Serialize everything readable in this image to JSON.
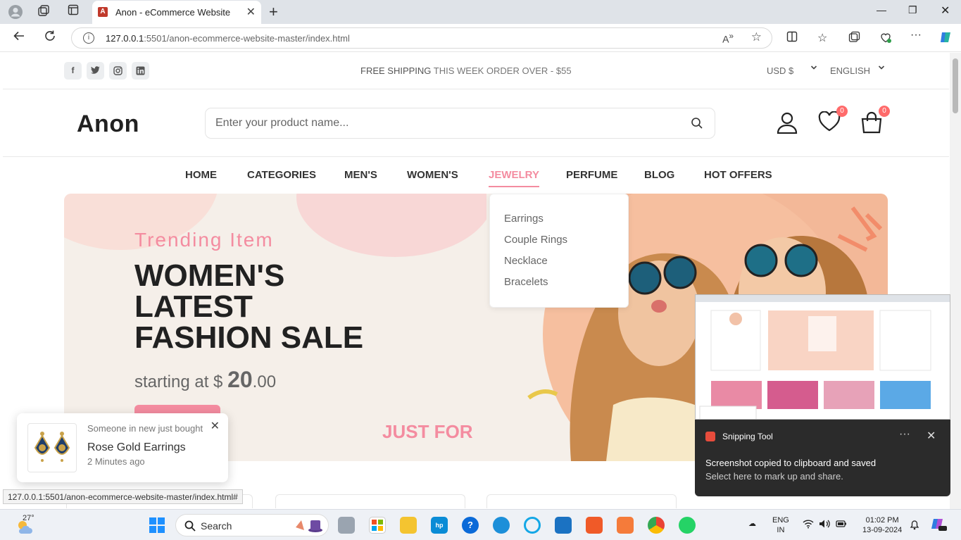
{
  "browser": {
    "tab_title": "Anon - eCommerce Website",
    "url_host": "127.0.0.1",
    "url_rest": ":5501/anon-ecommerce-website-master/index.html"
  },
  "topbar": {
    "shipping_strong": "FREE SHIPPING",
    "shipping_rest": " THIS WEEK ORDER OVER - $55",
    "currency": "USD $",
    "language": "ENGLISH"
  },
  "header": {
    "logo": "Anon",
    "search_placeholder": "Enter your product name...",
    "wishlist_count": "0",
    "cart_count": "0"
  },
  "nav": {
    "items": [
      "HOME",
      "CATEGORIES",
      "MEN'S",
      "WOMEN'S",
      "JEWELRY",
      "PERFUME",
      "BLOG",
      "HOT OFFERS"
    ],
    "active": "JEWELRY"
  },
  "jewelry_dropdown": [
    "Earrings",
    "Couple Rings",
    "Necklace",
    "Bracelets"
  ],
  "banner": {
    "subtitle": "Trending Item",
    "title_line1": "WOMEN'S",
    "title_line2": "LATEST",
    "title_line3": "FASHION SALE",
    "price_prefix": "starting at $ ",
    "price_int": "20",
    "price_dec": ".00",
    "just_for": "JUST FOR"
  },
  "toast": {
    "line1": "Someone in new just bought",
    "product": "Rose Gold Earrings",
    "time": "2 Minutes ago"
  },
  "status_url": "127.0.0.1:5501/anon-ecommerce-website-master/index.html#",
  "snipping": {
    "app": "Snipping Tool",
    "message": "Screenshot copied to clipboard and saved",
    "sub": "Select here to mark up and share."
  },
  "taskbar": {
    "temperature": "27°",
    "search": "Search",
    "lang1": "ENG",
    "lang2": "IN",
    "time": "01:02 PM",
    "date": "13-09-2024"
  },
  "colors": {
    "accent": "#f48ca0",
    "banner_bg": "#f5efe9",
    "text_dark": "#212121"
  }
}
